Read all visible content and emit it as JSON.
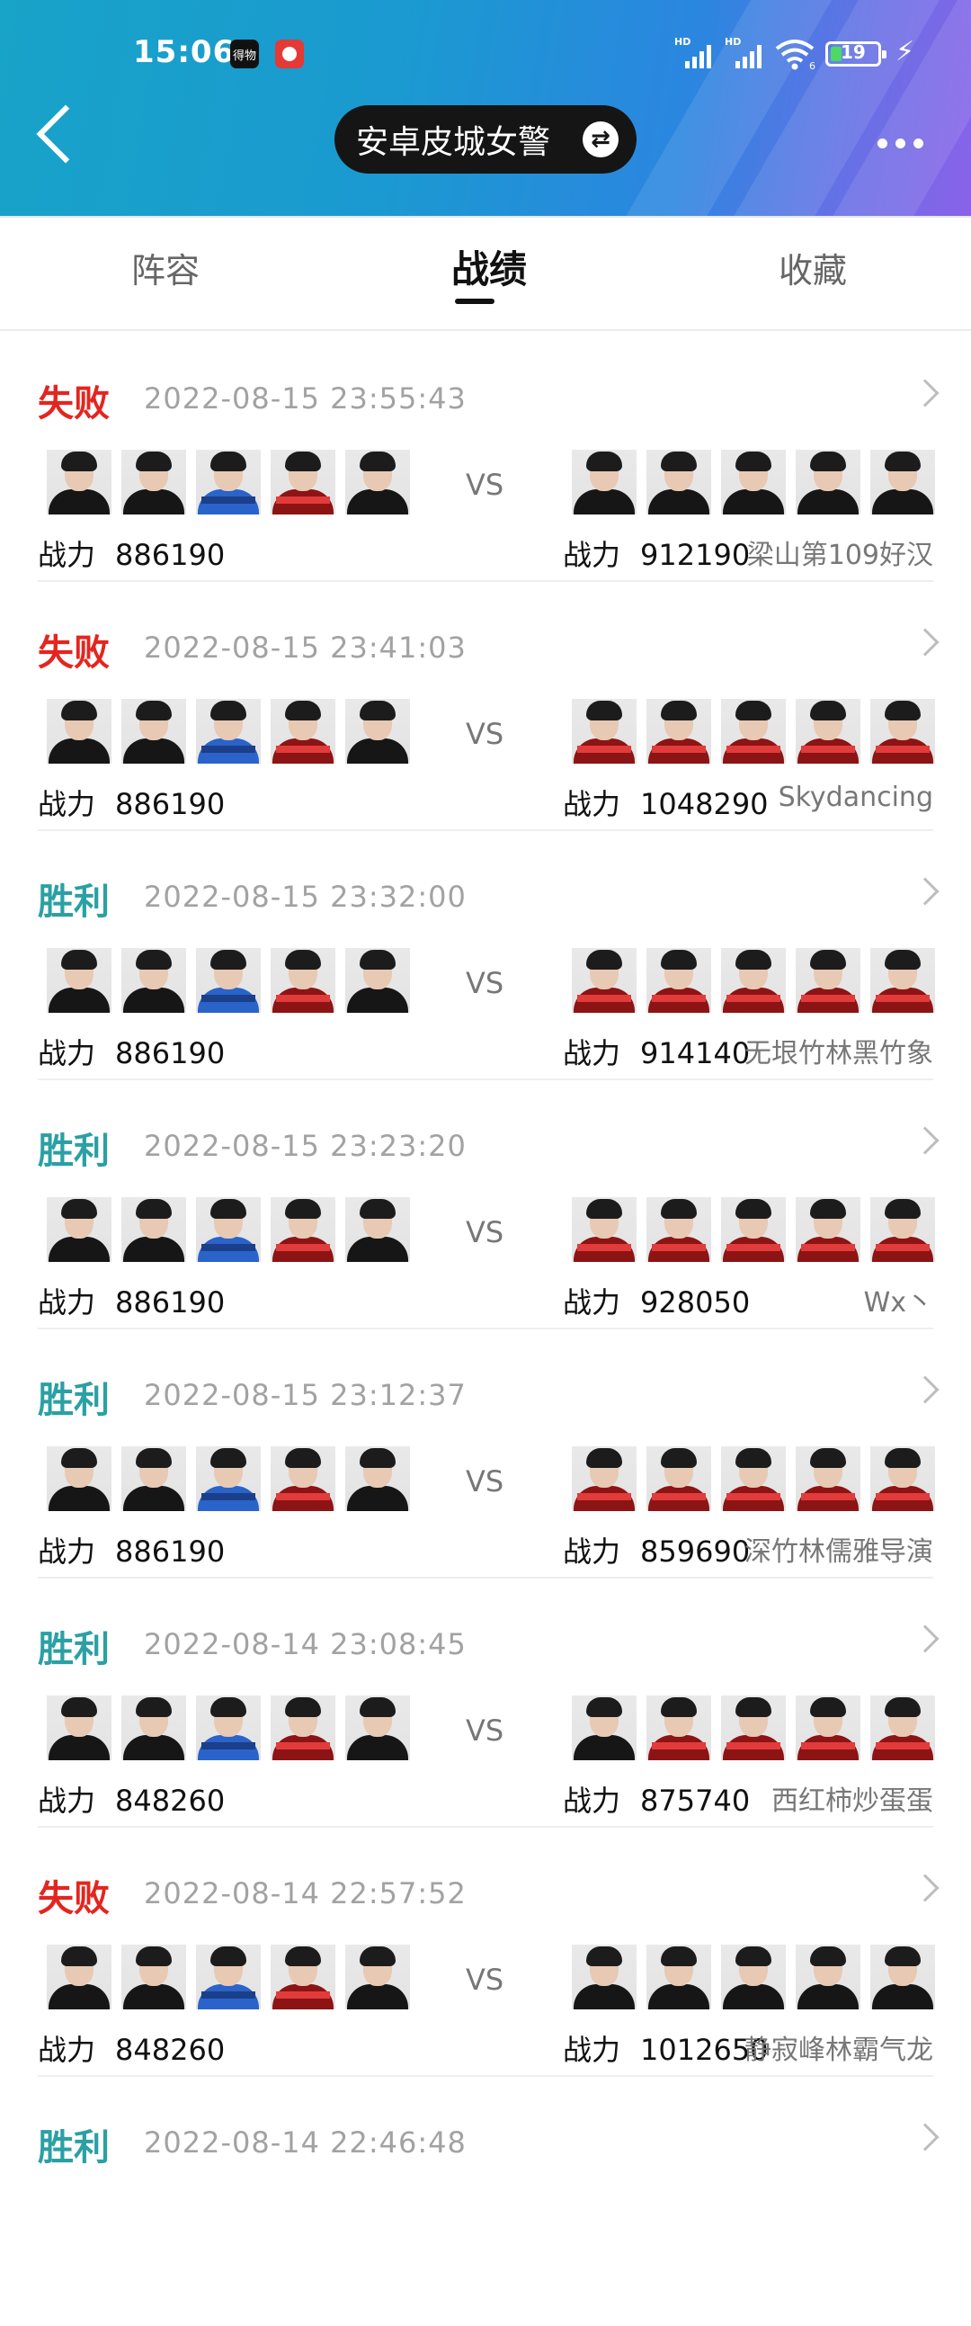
{
  "status_bar": {
    "time": "15:06",
    "app_icon_label": "得物",
    "signal1_label": "HD",
    "signal2_label": "HD",
    "wifi_label": "6",
    "battery_level": "19",
    "icons": [
      "dewu-app-icon",
      "red-app-icon",
      "signal-icon",
      "signal-icon",
      "wifi-icon",
      "battery-icon",
      "charging-icon"
    ]
  },
  "header": {
    "title": "安卓皮城女警",
    "back_icon": "chevron-left-icon",
    "swap_icon": "swap-icon",
    "more_icon": "more-icon",
    "gradient_start": "#18a3c8",
    "gradient_end": "#8a62e8"
  },
  "tabs": [
    {
      "label": "阵容",
      "active": false
    },
    {
      "label": "战绩",
      "active": true
    },
    {
      "label": "收藏",
      "active": false
    }
  ],
  "colors": {
    "lose": "#e4251f",
    "win": "#2aa0a4"
  },
  "power_label": "战力",
  "vs_label": "VS",
  "matches": [
    {
      "result": "失败",
      "type": "lose",
      "timestamp": "2022-08-15 23:55:43",
      "my_power": "886190",
      "opp_power": "912190",
      "opp_name": "梁山第109好汉"
    },
    {
      "result": "失败",
      "type": "lose",
      "timestamp": "2022-08-15 23:41:03",
      "my_power": "886190",
      "opp_power": "1048290",
      "opp_name": "Skydancing"
    },
    {
      "result": "胜利",
      "type": "win",
      "timestamp": "2022-08-15 23:32:00",
      "my_power": "886190",
      "opp_power": "914140",
      "opp_name": "无垠竹林黑竹象"
    },
    {
      "result": "胜利",
      "type": "win",
      "timestamp": "2022-08-15 23:23:20",
      "my_power": "886190",
      "opp_power": "928050",
      "opp_name": "Wx丶"
    },
    {
      "result": "胜利",
      "type": "win",
      "timestamp": "2022-08-15 23:12:37",
      "my_power": "886190",
      "opp_power": "859690",
      "opp_name": "深竹林儒雅导演"
    },
    {
      "result": "胜利",
      "type": "win",
      "timestamp": "2022-08-14 23:08:45",
      "my_power": "848260",
      "opp_power": "875740",
      "opp_name": "西红柿炒蛋蛋"
    },
    {
      "result": "失败",
      "type": "lose",
      "timestamp": "2022-08-14 22:57:52",
      "my_power": "848260",
      "opp_power": "1012650",
      "opp_name": "静寂峰林霸气龙"
    },
    {
      "result": "胜利",
      "type": "win",
      "timestamp": "2022-08-14 22:46:48",
      "my_power": "",
      "opp_power": "",
      "opp_name": ""
    }
  ]
}
